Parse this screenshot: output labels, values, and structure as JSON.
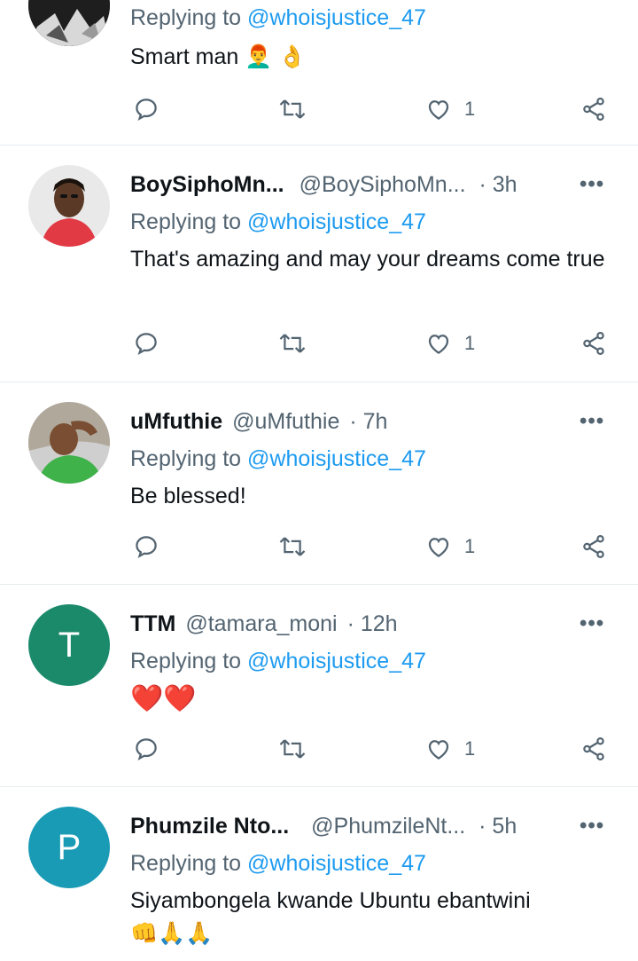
{
  "tweets": [
    {
      "reply_prefix": "Replying to",
      "reply_to": "@whoisjustice_47",
      "text": "Smart man 👨‍🦰 👌",
      "like_count": "1"
    },
    {
      "name": "BoySiphoMn...",
      "handle": "@BoySiphoMn...",
      "sep": "·",
      "time": "3h",
      "reply_prefix": "Replying to",
      "reply_to": "@whoisjustice_47",
      "text": "That's amazing and may your dreams come true",
      "like_count": "1"
    },
    {
      "name": "uMfuthie",
      "handle": "@uMfuthie",
      "sep": "·",
      "time": "7h",
      "reply_prefix": "Replying to",
      "reply_to": "@whoisjustice_47",
      "text": "Be blessed!",
      "like_count": "1"
    },
    {
      "name": "TTM",
      "handle": "@tamara_moni",
      "sep": "·",
      "time": "12h",
      "avatar_letter": "T",
      "avatar_color": "#1b8a6b",
      "reply_prefix": "Replying to",
      "reply_to": "@whoisjustice_47",
      "text": "❤️❤️",
      "like_count": "1"
    },
    {
      "name": "Phumzile Nto...",
      "handle": "@PhumzileNt...",
      "sep": "·",
      "time": "5h",
      "avatar_letter": "P",
      "avatar_color": "#1a9bb5",
      "reply_prefix": "Replying to",
      "reply_to": "@whoisjustice_47",
      "text": "Siyambongela kwande Ubuntu ebantwini",
      "text_emoji": "👊🙏🙏"
    }
  ],
  "icons": {
    "reply": "reply-icon",
    "retweet": "retweet-icon",
    "like": "heart-icon",
    "share": "share-icon",
    "more": "more-icon"
  },
  "colors": {
    "link": "#1d9bf0",
    "secondary": "#536471",
    "heart": "#e0245e"
  }
}
